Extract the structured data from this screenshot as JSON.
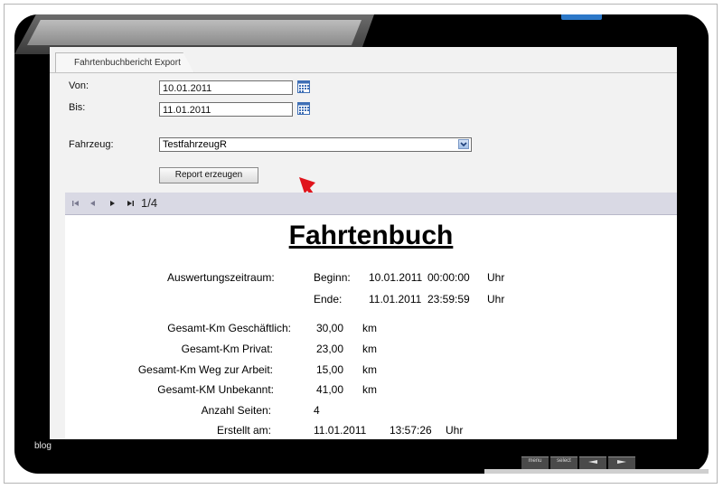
{
  "tab": {
    "label": "Fahrtenbuchbericht Export"
  },
  "form": {
    "von_label": "Von:",
    "von_value": "10.01.2011",
    "bis_label": "Bis:",
    "bis_value": "11.01.2011",
    "fahrzeug_label": "Fahrzeug:",
    "fahrzeug_value": "TestfahrzeugR",
    "report_button": "Report erzeugen"
  },
  "toolbar": {
    "page_indicator": "1/4"
  },
  "report": {
    "title": "Fahrtenbuch",
    "zeitraum_label": "Auswertungszeitraum:",
    "beginn_label": "Beginn:",
    "beginn_date": "10.01.2011",
    "beginn_time": "00:00:00",
    "beginn_unit": "Uhr",
    "ende_label": "Ende:",
    "ende_date": "11.01.2011",
    "ende_time": "23:59:59",
    "ende_unit": "Uhr",
    "rows": [
      {
        "label": "Gesamt-Km Geschäftlich:",
        "value": "30,00",
        "unit": "km"
      },
      {
        "label": "Gesamt-Km Privat:",
        "value": "23,00",
        "unit": "km"
      },
      {
        "label": "Gesamt-Km Weg zur Arbeit:",
        "value": "15,00",
        "unit": "km"
      },
      {
        "label": "Gesamt-KM Unbekannt:",
        "value": "41,00",
        "unit": "km"
      }
    ],
    "seiten_label": "Anzahl Seiten:",
    "seiten_value": "4",
    "erstellt_label": "Erstellt am:",
    "erstellt_date": "11.01.2011",
    "erstellt_time": "13:57:26",
    "erstellt_unit": "Uhr"
  },
  "device": {
    "brand_label": "blog",
    "buttons": [
      "menu",
      "select",
      "",
      ""
    ]
  },
  "colors": {
    "led": "#2c78c8",
    "toolbar": "#d9d9e4",
    "arrow": "#e0141c"
  }
}
